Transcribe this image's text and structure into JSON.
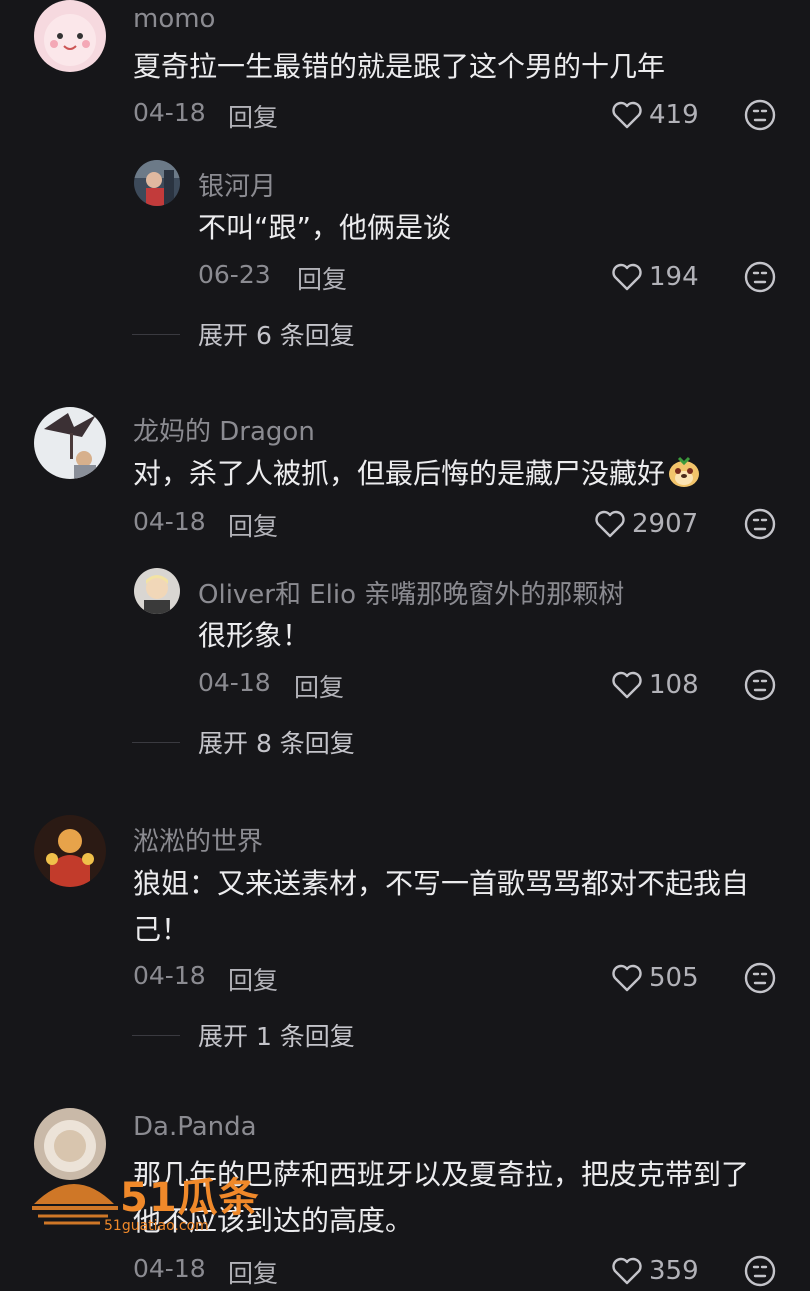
{
  "comments": [
    {
      "username": "momo",
      "text": [
        "夏奇拉一生最错的就是跟了这个男的十几年"
      ],
      "date": "04-18",
      "reply_label": "回复",
      "likes": "419",
      "reply": {
        "username": "银河月",
        "text": "不叫“跟”，他俩是谈",
        "date": "06-23",
        "reply_label": "回复",
        "likes": "194"
      },
      "expand_label": "展开 6 条回复"
    },
    {
      "username": "龙妈的 Dragon",
      "text": [
        "对，杀了人被抓，但最后悔的是藏尸没藏好"
      ],
      "date": "04-18",
      "reply_label": "回复",
      "likes": "2907",
      "reply": {
        "username": "Oliver和 Elio 亲嘴那晚窗外的那颗树",
        "text": "很形象！",
        "date": "04-18",
        "reply_label": "回复",
        "likes": "108"
      },
      "expand_label": "展开 8 条回复"
    },
    {
      "username": "淞淞的世界",
      "text": [
        "狼姐：又来送素材，不写一首歌骂骂都对不起我自",
        "己！"
      ],
      "date": "04-18",
      "reply_label": "回复",
      "likes": "505",
      "expand_label": "展开 1 条回复"
    },
    {
      "username": "Da.Panda",
      "text": [
        "那几年的巴萨和西班牙以及夏奇拉，把皮克带到了",
        "他不应该到达的高度。"
      ],
      "date": "04-18",
      "reply_label": "回复",
      "likes": "359"
    }
  ],
  "watermark": {
    "brand": "51瓜条",
    "url": "51guatiao.com"
  },
  "colors": {
    "background": "#161619",
    "primary_text": "#ececee",
    "secondary_text": "#8b8b91",
    "watermark": "#f0892a"
  }
}
